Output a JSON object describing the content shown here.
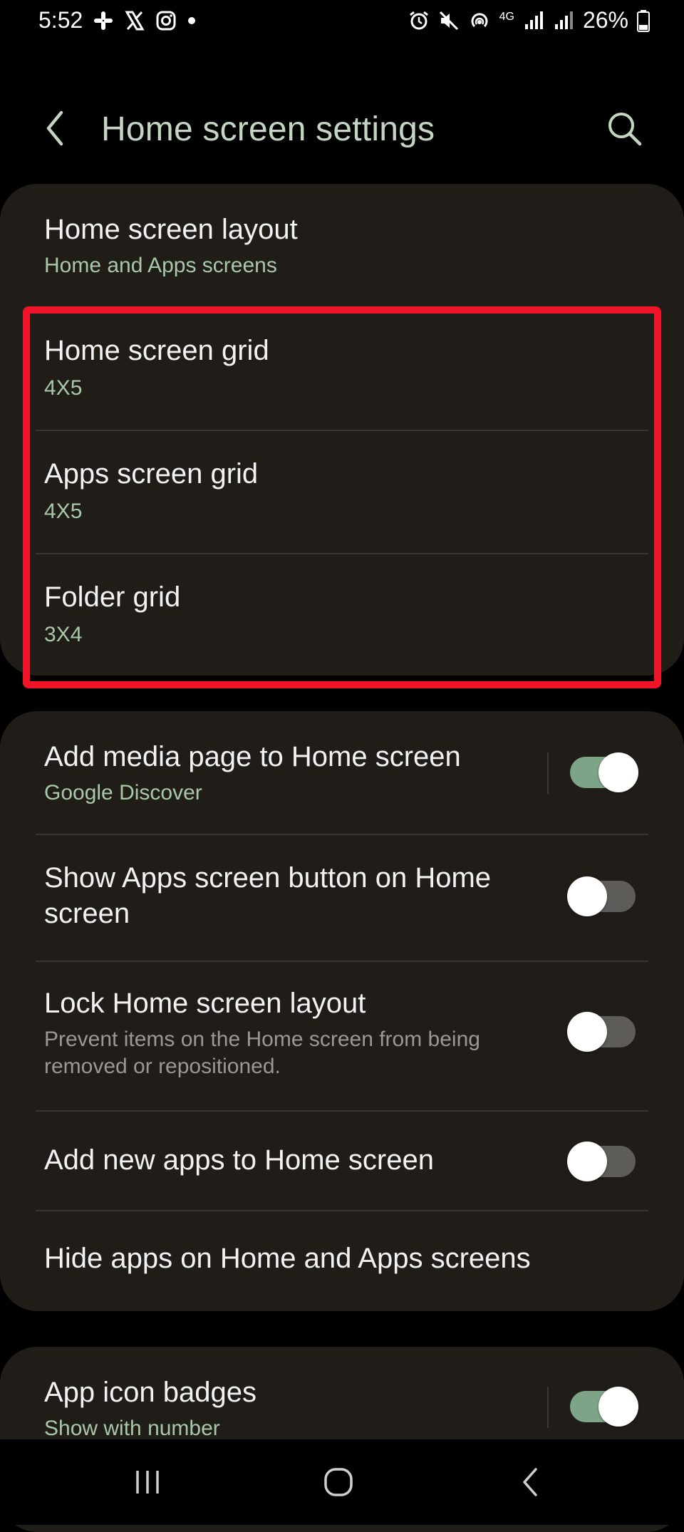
{
  "status_bar": {
    "time": "5:52",
    "battery": "26%",
    "network": "4G",
    "left_icons": [
      "slack-icon",
      "x-icon",
      "instagram-icon",
      "dot-icon"
    ],
    "right_icons": [
      "alarm-icon",
      "mute-icon",
      "hotspot-icon",
      "signal-icon",
      "signal-icon",
      "battery-icon"
    ]
  },
  "header": {
    "title": "Home screen settings",
    "back_icon": "chevron-left-icon",
    "search_icon": "search-icon"
  },
  "group1": [
    {
      "title": "Home screen layout",
      "subtitle": "Home and Apps screens"
    },
    {
      "title": "Home screen grid",
      "subtitle": "4X5"
    },
    {
      "title": "Apps screen grid",
      "subtitle": "4X5"
    },
    {
      "title": "Folder grid",
      "subtitle": "3X4"
    }
  ],
  "group2": [
    {
      "title": "Add media page to Home screen",
      "subtitle": "Google Discover",
      "toggle": true
    },
    {
      "title_line1": "Show Apps screen button on Home",
      "title_line2": "screen",
      "toggle": false
    },
    {
      "title": "Lock Home screen layout",
      "subtitle": "Prevent items on the Home screen from being removed or repositioned.",
      "toggle": false
    },
    {
      "title": "Add new apps to Home screen",
      "toggle": false
    },
    {
      "title": "Hide apps on Home and Apps screens"
    }
  ],
  "group3": [
    {
      "title": "App icon badges",
      "subtitle": "Show with number",
      "toggle": true
    }
  ],
  "colors": {
    "accent": "#7ea487",
    "title": "#c4d6c3",
    "subtitle": "#a9c7a9",
    "card": "#201d19",
    "highlight": "#f01428"
  },
  "nav_bar": {
    "recents_icon": "recents-icon",
    "home_icon": "home-icon",
    "back_icon": "back-icon"
  }
}
